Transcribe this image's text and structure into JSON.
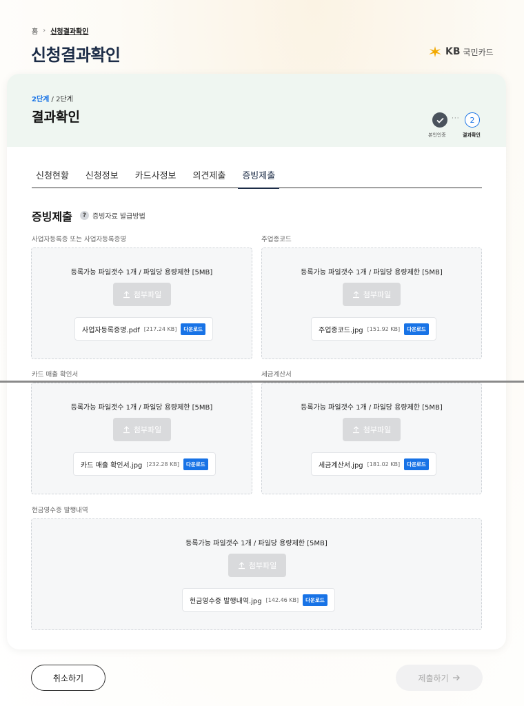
{
  "breadcrumb": {
    "home": "홈",
    "current": "신청결과확인"
  },
  "page": {
    "title": "신청결과확인"
  },
  "logo": {
    "kb": "KB",
    "name": "국민카드"
  },
  "steps": {
    "current": "2단계",
    "separator": " / ",
    "total": "2단계",
    "title": "결과확인",
    "step1_label": "본인인증",
    "step2_number": "2",
    "step2_label": "결과확인",
    "dots": "···"
  },
  "tabs": [
    {
      "label": "신청현황",
      "active": false
    },
    {
      "label": "신청정보",
      "active": false
    },
    {
      "label": "카드사정보",
      "active": false
    },
    {
      "label": "의견제출",
      "active": false
    },
    {
      "label": "증빙제출",
      "active": true
    }
  ],
  "section": {
    "title": "증빙제출",
    "help_label": "증빙자료 발급방법",
    "help_icon": "question-icon"
  },
  "upload_limit": "등록가능 파일갯수 1개 / 파일당 용량제한 [5MB]",
  "attach_label": "첨부파일",
  "download_label": "다운로드",
  "uploads": [
    {
      "label": "사업자등록증 또는 사업자등록증명",
      "file_name": "사업자등록증명.pdf",
      "file_size": "[217.24 KB]"
    },
    {
      "label": "주업종코드",
      "file_name": "주업종코드.jpg",
      "file_size": "[151.92 KB]"
    },
    {
      "label": "카드 매출 확인서",
      "file_name": "카드 매출 확인서.jpg",
      "file_size": "[232.28 KB]"
    },
    {
      "label": "세금계산서",
      "file_name": "세금계산서.jpg",
      "file_size": "[181.02 KB]"
    },
    {
      "label": "현금영수증 발행내역",
      "file_name": "현금영수증 발행내역.jpg",
      "file_size": "[142.46 KB]"
    }
  ],
  "buttons": {
    "cancel": "취소하기",
    "submit": "제출하기"
  },
  "colors": {
    "accent": "#1873e6",
    "title": "#1c2c47",
    "header_bg": "#eff6f1"
  }
}
